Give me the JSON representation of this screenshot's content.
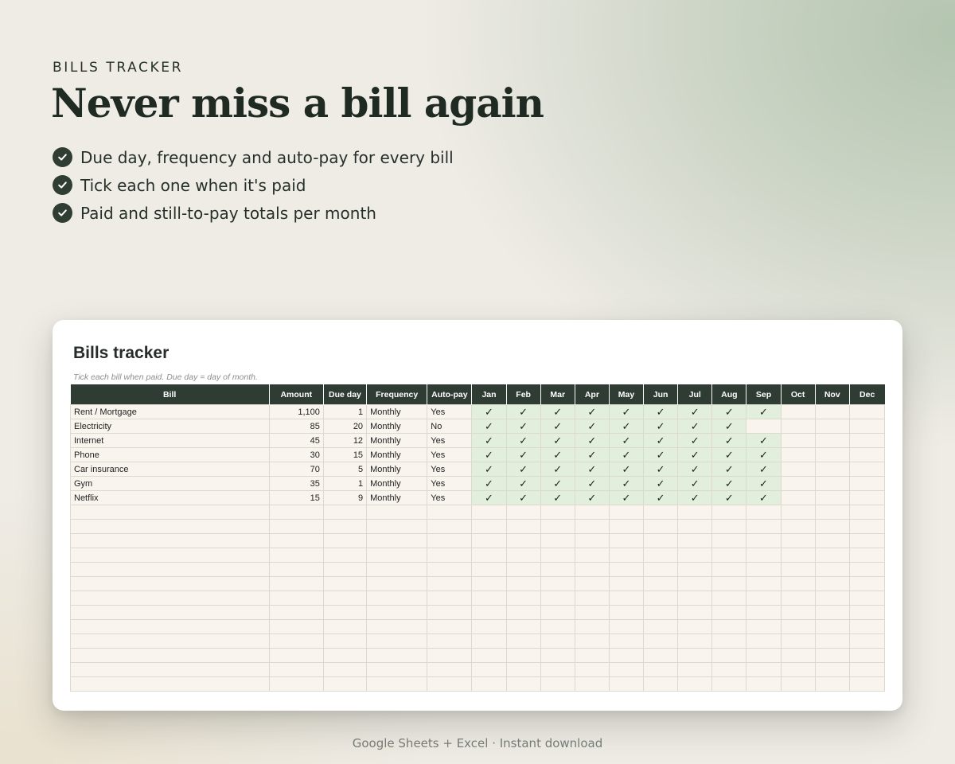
{
  "hero": {
    "eyebrow": "BILLS TRACKER",
    "headline": "Never miss a bill again",
    "features": [
      "Due day, frequency and auto-pay for every bill",
      "Tick each one when it's paid",
      "Paid and still-to-pay totals per month"
    ]
  },
  "sheet": {
    "title": "Bills tracker",
    "note": "Tick each bill when paid. Due day = day of month.",
    "columns": [
      "Bill",
      "Amount",
      "Due day",
      "Frequency",
      "Auto-pay",
      "Jan",
      "Feb",
      "Mar",
      "Apr",
      "May",
      "Jun",
      "Jul",
      "Aug",
      "Sep",
      "Oct",
      "Nov",
      "Dec"
    ],
    "check_mark": "✓",
    "rows": [
      {
        "bill": "Rent / Mortgage",
        "amount": "1,100",
        "due_day": "1",
        "frequency": "Monthly",
        "autopay": "Yes",
        "paid": [
          1,
          1,
          1,
          1,
          1,
          1,
          1,
          1,
          1,
          0,
          0,
          0
        ]
      },
      {
        "bill": "Electricity",
        "amount": "85",
        "due_day": "20",
        "frequency": "Monthly",
        "autopay": "No",
        "paid": [
          1,
          1,
          1,
          1,
          1,
          1,
          1,
          1,
          0,
          0,
          0,
          0
        ]
      },
      {
        "bill": "Internet",
        "amount": "45",
        "due_day": "12",
        "frequency": "Monthly",
        "autopay": "Yes",
        "paid": [
          1,
          1,
          1,
          1,
          1,
          1,
          1,
          1,
          1,
          0,
          0,
          0
        ]
      },
      {
        "bill": "Phone",
        "amount": "30",
        "due_day": "15",
        "frequency": "Monthly",
        "autopay": "Yes",
        "paid": [
          1,
          1,
          1,
          1,
          1,
          1,
          1,
          1,
          1,
          0,
          0,
          0
        ]
      },
      {
        "bill": "Car insurance",
        "amount": "70",
        "due_day": "5",
        "frequency": "Monthly",
        "autopay": "Yes",
        "paid": [
          1,
          1,
          1,
          1,
          1,
          1,
          1,
          1,
          1,
          0,
          0,
          0
        ]
      },
      {
        "bill": "Gym",
        "amount": "35",
        "due_day": "1",
        "frequency": "Monthly",
        "autopay": "Yes",
        "paid": [
          1,
          1,
          1,
          1,
          1,
          1,
          1,
          1,
          1,
          0,
          0,
          0
        ]
      },
      {
        "bill": "Netflix",
        "amount": "15",
        "due_day": "9",
        "frequency": "Monthly",
        "autopay": "Yes",
        "paid": [
          1,
          1,
          1,
          1,
          1,
          1,
          1,
          1,
          1,
          0,
          0,
          0
        ]
      }
    ],
    "empty_rows": 13
  },
  "footer": {
    "text": "Google Sheets + Excel  ·  Instant download"
  },
  "colors": {
    "header_bg": "#2e3c33",
    "paid_cell": "#e3efdd",
    "cell_bg": "#f9f5ee",
    "grid_line": "#dcd9cf"
  },
  "icons": {
    "feature_bullet": "check-circle-icon"
  }
}
